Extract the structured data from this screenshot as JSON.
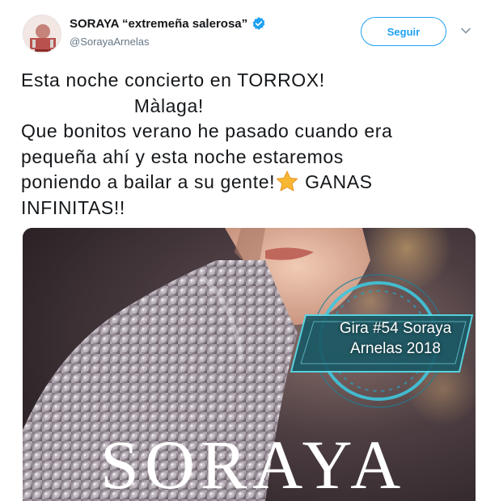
{
  "author": {
    "display_name": "SORAYA “extremeña salerosa”",
    "handle": "@SorayaArnelas",
    "verified": true,
    "avatar_icon": "profile-avatar"
  },
  "actions": {
    "follow_label": "Seguir",
    "menu_icon": "chevron-down-icon"
  },
  "tweet": {
    "lines": [
      "Esta noche concierto en TORROX!",
      "                    Màlaga!",
      "Que bonitos verano he pasado cuando era",
      "pequeña ahí y esta noche estaremos",
      "poniendo a bailar a su gente!",
      " GANAS",
      "INFINITAS!!"
    ],
    "emoji": "star-emoji"
  },
  "media": {
    "badge_line1": "Gira #54 Soraya",
    "badge_line2": "Arnelas 2018",
    "logo_text": "SORAYA"
  },
  "colors": {
    "accent": "#1da1f2",
    "text": "#14171a",
    "muted": "#657786"
  }
}
